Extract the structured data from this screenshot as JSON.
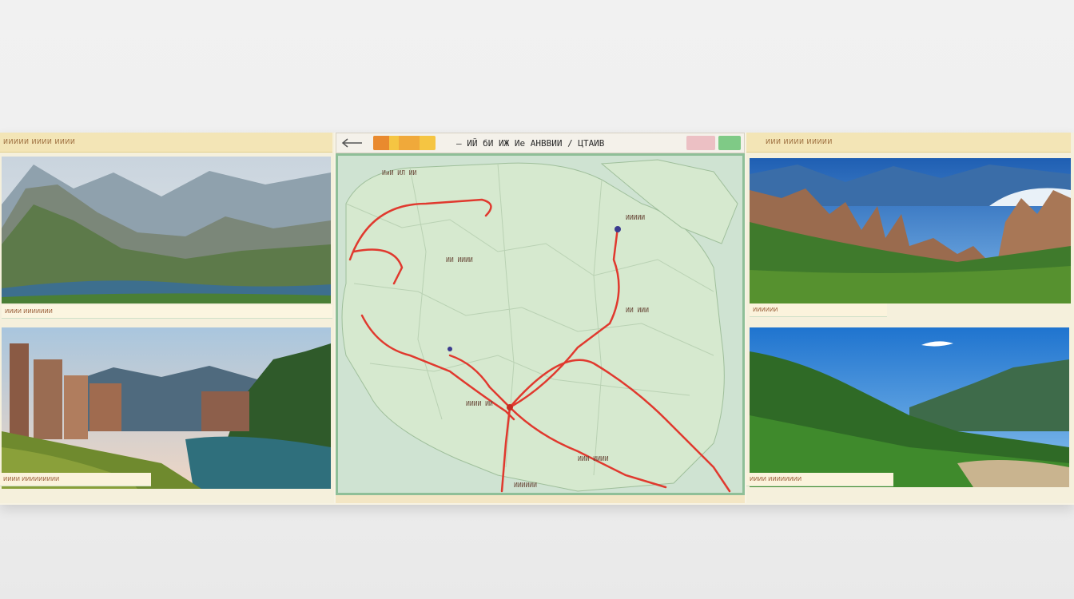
{
  "map_panel": {
    "title": "— ИЙ бИ ИЖ Ие АНВВИИ / ЦТАИВ",
    "back_icon": "arrow-left-icon",
    "place_labels": [
      "ИиИ ИЛ ИИ",
      "ИИ ИИИИ",
      "ИИИИИ",
      "ИИ ИИИ",
      "ИИИИ ИИ",
      "ИИИ ИИИИ",
      "ИИИИИИ"
    ]
  },
  "photos": [
    {
      "caption": "ИИИИИ ИИИИ ИИИИ",
      "label": "ИИИИ ИИИИИИИ"
    },
    {
      "caption": "",
      "label": "ИИИИ ИИИИИИИИИ"
    },
    {
      "caption": "ИИИ ИИИИ ИИИИИ",
      "label": "ИИИИИИ"
    },
    {
      "caption": "",
      "label": "ИИИИ ИИИИИИИИ"
    }
  ],
  "colors": {
    "route": "#e0392e",
    "land": "#d6e9cf",
    "water": "#cfe3d2",
    "accent_green": "#7fca86",
    "accent_pink": "#ecc0c4",
    "accent_orange": "#f5c542"
  }
}
